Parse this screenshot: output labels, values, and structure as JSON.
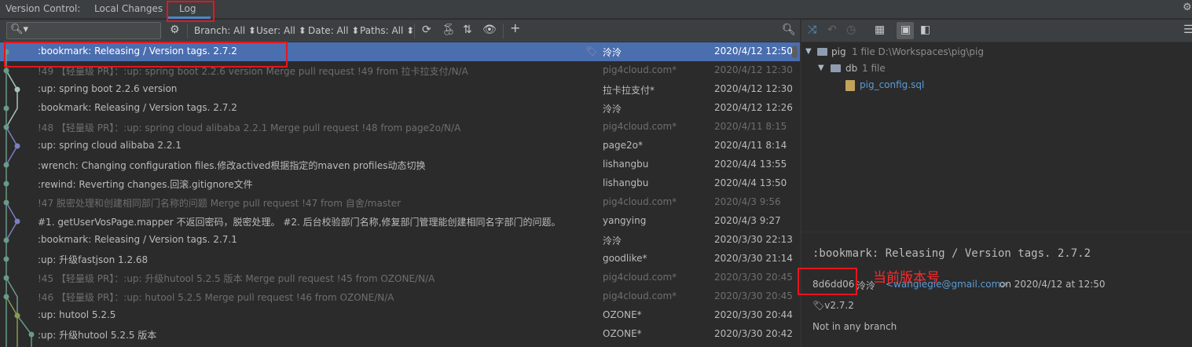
{
  "tabbar": {
    "title": "Version Control:",
    "tabs": [
      {
        "label": "Local Changes"
      },
      {
        "label": "Log"
      }
    ]
  },
  "toolbar": {
    "search_placeholder": "",
    "filters": {
      "branch": "Branch: All",
      "user": "User: All",
      "date": "Date: All",
      "paths": "Paths: All"
    },
    "icons": [
      "search-icon",
      "gear-icon",
      "refresh-icon",
      "cherry-pick-icon",
      "sort-icon",
      "eye-icon",
      "add-icon"
    ]
  },
  "commits": [
    {
      "message": ":bookmark: Releasing / Version tags. 2.7.2",
      "author": "泠泠",
      "date": "2020/4/12 12:50",
      "selected": true,
      "tagged": true,
      "dim": false
    },
    {
      "message": "!49 【轻量级 PR】：:up: spring boot 2.2.6 version   Merge pull request !49 from 拉卡拉支付/N/A",
      "author": "pig4cloud.com*",
      "date": "2020/4/12 12:30",
      "dim": true
    },
    {
      "message": ":up: spring boot 2.2.6 version",
      "author": "拉卡拉支付*",
      "date": "2020/4/12 12:30",
      "dim": false
    },
    {
      "message": ":bookmark: Releasing / Version tags. 2.7.2",
      "author": "泠泠",
      "date": "2020/4/12 12:26",
      "dim": false
    },
    {
      "message": "!48 【轻量级 PR】：:up:  spring cloud alibaba 2.2.1 Merge pull request !48 from page2o/N/A",
      "author": "pig4cloud.com*",
      "date": "2020/4/11 8:15",
      "dim": true
    },
    {
      "message": ":up:  spring cloud alibaba 2.2.1",
      "author": "page2o*",
      "date": "2020/4/11 8:14",
      "dim": false
    },
    {
      "message": ":wrench: Changing configuration files.修改actived根据指定的maven profiles动态切换",
      "author": "lishangbu",
      "date": "2020/4/4 13:55",
      "dim": false
    },
    {
      "message": ":rewind: Reverting changes.回滚.gitignore文件",
      "author": "lishangbu",
      "date": "2020/4/4 13:50",
      "dim": false
    },
    {
      "message": "!47 脱密处理和创建相同部门名称的问题 Merge pull request !47 from 自舍/master",
      "author": "pig4cloud.com*",
      "date": "2020/4/3 9:56",
      "dim": true
    },
    {
      "message": "#1. getUserVosPage.mapper 不返回密码，脱密处理。 #2. 后台校验部门名称,修复部门管理能创建相同名字部门的问题。",
      "author": "yangying",
      "date": "2020/4/3 9:27",
      "dim": false
    },
    {
      "message": ":bookmark: Releasing / Version tags. 2.7.1",
      "author": "泠泠",
      "date": "2020/3/30 22:13",
      "dim": false
    },
    {
      "message": ":up: 升级fastjson 1.2.68",
      "author": "goodlike*",
      "date": "2020/3/30 21:14",
      "dim": false
    },
    {
      "message": "!45 【轻量级 PR】：:up: 升级hutool 5.2.5 版本 Merge pull request !45 from OZONE/N/A",
      "author": "pig4cloud.com*",
      "date": "2020/3/30 20:45",
      "dim": true
    },
    {
      "message": "!46 【轻量级 PR】：:up: hutool 5.2.5 Merge pull request !46 from OZONE/N/A",
      "author": "pig4cloud.com*",
      "date": "2020/3/30 20:45",
      "dim": true
    },
    {
      "message": ":up: hutool 5.2.5",
      "author": "OZONE*",
      "date": "2020/3/30 20:44",
      "dim": false
    },
    {
      "message": ":up: 升级hutool 5.2.5 版本",
      "author": "OZONE*",
      "date": "2020/3/30 20:42",
      "dim": false
    }
  ],
  "tree": {
    "root_name": "pig",
    "root_info": "1 file  D:\\Workspaces\\pig\\pig",
    "folder_name": "db",
    "folder_info": "1 file",
    "file_name": "pig_config.sql"
  },
  "details": {
    "title": ":bookmark: Releasing / Version tags. 2.7.2",
    "hash": "8d6dd06",
    "author": "泠泠",
    "email": "<wangiegie@gmail.com>",
    "on_date": "on 2020/4/12 at 12:50",
    "tag": "v2.7.2",
    "branch": "Not in any branch"
  },
  "annotation": {
    "label": "当前版本号",
    "color": "#ff2a2a"
  },
  "colors": {
    "selection": "#4b6eaf",
    "background": "#2b2b2b",
    "graph": "#6a9a88",
    "graph_alt": "#6a6aa6"
  }
}
